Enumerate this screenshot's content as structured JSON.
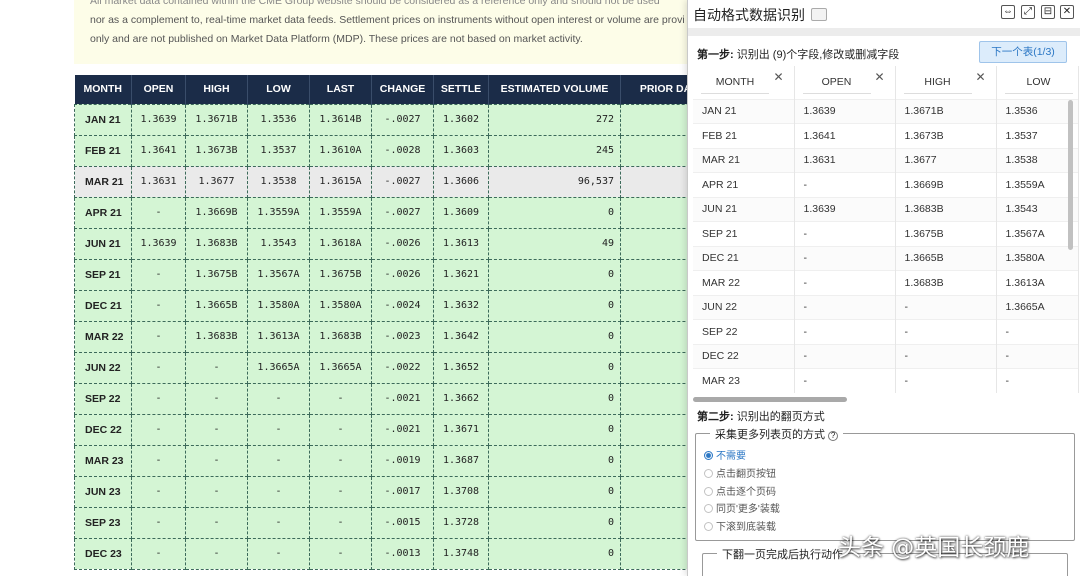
{
  "notice": {
    "line0": "All market data contained within the CME Group website should be considered as a reference only and should not be used",
    "line1": "nor as a complement to, real-time market data feeds. Settlement prices on instruments without open interest or volume are provi",
    "line2": "only and are not published on Market Data Platform (MDP). These prices are not based on market activity."
  },
  "market_table": {
    "headers": [
      "MONTH",
      "OPEN",
      "HIGH",
      "LOW",
      "LAST",
      "CHANGE",
      "SETTLE",
      "ESTIMATED VOLUME",
      "PRIOR DA"
    ],
    "rows": [
      [
        "JAN 21",
        "1.3639",
        "1.3671B",
        "1.3536",
        "1.3614B",
        "-.0027",
        "1.3602",
        "272",
        ""
      ],
      [
        "FEB 21",
        "1.3641",
        "1.3673B",
        "1.3537",
        "1.3610A",
        "-.0028",
        "1.3603",
        "245",
        ""
      ],
      [
        "MAR 21",
        "1.3631",
        "1.3677",
        "1.3538",
        "1.3615A",
        "-.0027",
        "1.3606",
        "96,537",
        ""
      ],
      [
        "APR 21",
        "-",
        "1.3669B",
        "1.3559A",
        "1.3559A",
        "-.0027",
        "1.3609",
        "0",
        ""
      ],
      [
        "JUN 21",
        "1.3639",
        "1.3683B",
        "1.3543",
        "1.3618A",
        "-.0026",
        "1.3613",
        "49",
        ""
      ],
      [
        "SEP 21",
        "-",
        "1.3675B",
        "1.3567A",
        "1.3675B",
        "-.0026",
        "1.3621",
        "0",
        ""
      ],
      [
        "DEC 21",
        "-",
        "1.3665B",
        "1.3580A",
        "1.3580A",
        "-.0024",
        "1.3632",
        "0",
        ""
      ],
      [
        "MAR 22",
        "-",
        "1.3683B",
        "1.3613A",
        "1.3683B",
        "-.0023",
        "1.3642",
        "0",
        ""
      ],
      [
        "JUN 22",
        "-",
        "-",
        "1.3665A",
        "1.3665A",
        "-.0022",
        "1.3652",
        "0",
        ""
      ],
      [
        "SEP 22",
        "-",
        "-",
        "-",
        "-",
        "-.0021",
        "1.3662",
        "0",
        ""
      ],
      [
        "DEC 22",
        "-",
        "-",
        "-",
        "-",
        "-.0021",
        "1.3671",
        "0",
        ""
      ],
      [
        "MAR 23",
        "-",
        "-",
        "-",
        "-",
        "-.0019",
        "1.3687",
        "0",
        ""
      ],
      [
        "JUN 23",
        "-",
        "-",
        "-",
        "-",
        "-.0017",
        "1.3708",
        "0",
        ""
      ],
      [
        "SEP 23",
        "-",
        "-",
        "-",
        "-",
        "-.0015",
        "1.3728",
        "0",
        ""
      ],
      [
        "DEC 23",
        "-",
        "-",
        "-",
        "-",
        "-.0013",
        "1.3748",
        "0",
        ""
      ]
    ],
    "highlight_row": 2
  },
  "panel": {
    "title": "自动格式数据识别",
    "doc_icon": "document-icon",
    "window_buttons": [
      {
        "name": "shrink-icon",
        "glyph": "⇔"
      },
      {
        "name": "expand-icon",
        "glyph": "⤢"
      },
      {
        "name": "save-icon",
        "glyph": "⊟"
      },
      {
        "name": "close-icon",
        "glyph": "✕"
      }
    ],
    "step1_label": "第一步:",
    "step1_text": "识别出 (9)个字段,修改或删减字段",
    "next_table_button": "下一个表(1/3)",
    "preview": {
      "headers": [
        "MONTH",
        "OPEN",
        "HIGH",
        "LOW"
      ],
      "remove_glyph": "✕",
      "rows": [
        [
          "JAN 21",
          "1.3639",
          "1.3671B",
          "1.3536"
        ],
        [
          "FEB 21",
          "1.3641",
          "1.3673B",
          "1.3537"
        ],
        [
          "MAR 21",
          "1.3631",
          "1.3677",
          "1.3538"
        ],
        [
          "APR 21",
          "-",
          "1.3669B",
          "1.3559A"
        ],
        [
          "JUN 21",
          "1.3639",
          "1.3683B",
          "1.3543"
        ],
        [
          "SEP 21",
          "-",
          "1.3675B",
          "1.3567A"
        ],
        [
          "DEC 21",
          "-",
          "1.3665B",
          "1.3580A"
        ],
        [
          "MAR 22",
          "-",
          "1.3683B",
          "1.3613A"
        ],
        [
          "JUN 22",
          "-",
          "-",
          "1.3665A"
        ],
        [
          "SEP 22",
          "-",
          "-",
          "-"
        ],
        [
          "DEC 22",
          "-",
          "-",
          "-"
        ],
        [
          "MAR 23",
          "-",
          "-",
          "-"
        ]
      ]
    },
    "step2_label": "第二步:",
    "step2_text": "识别出的翻页方式",
    "paging_legend": "采集更多列表页的方式",
    "help_glyph": "?",
    "paging_options": [
      {
        "label": "不需要",
        "selected": true
      },
      {
        "label": "点击翻页按钮",
        "selected": false
      },
      {
        "label": "点击逐个页码",
        "selected": false
      },
      {
        "label": "同页'更多'装载",
        "selected": false
      },
      {
        "label": "下滚到底装载",
        "selected": false
      }
    ],
    "after_page_legend": "下翻一页完成后执行动作"
  },
  "watermark": "头条 @英国长颈鹿",
  "colors": {
    "header_navy": "#1b2c48",
    "row_green": "#d4f5d4",
    "accent_blue": "#2a76c4"
  }
}
